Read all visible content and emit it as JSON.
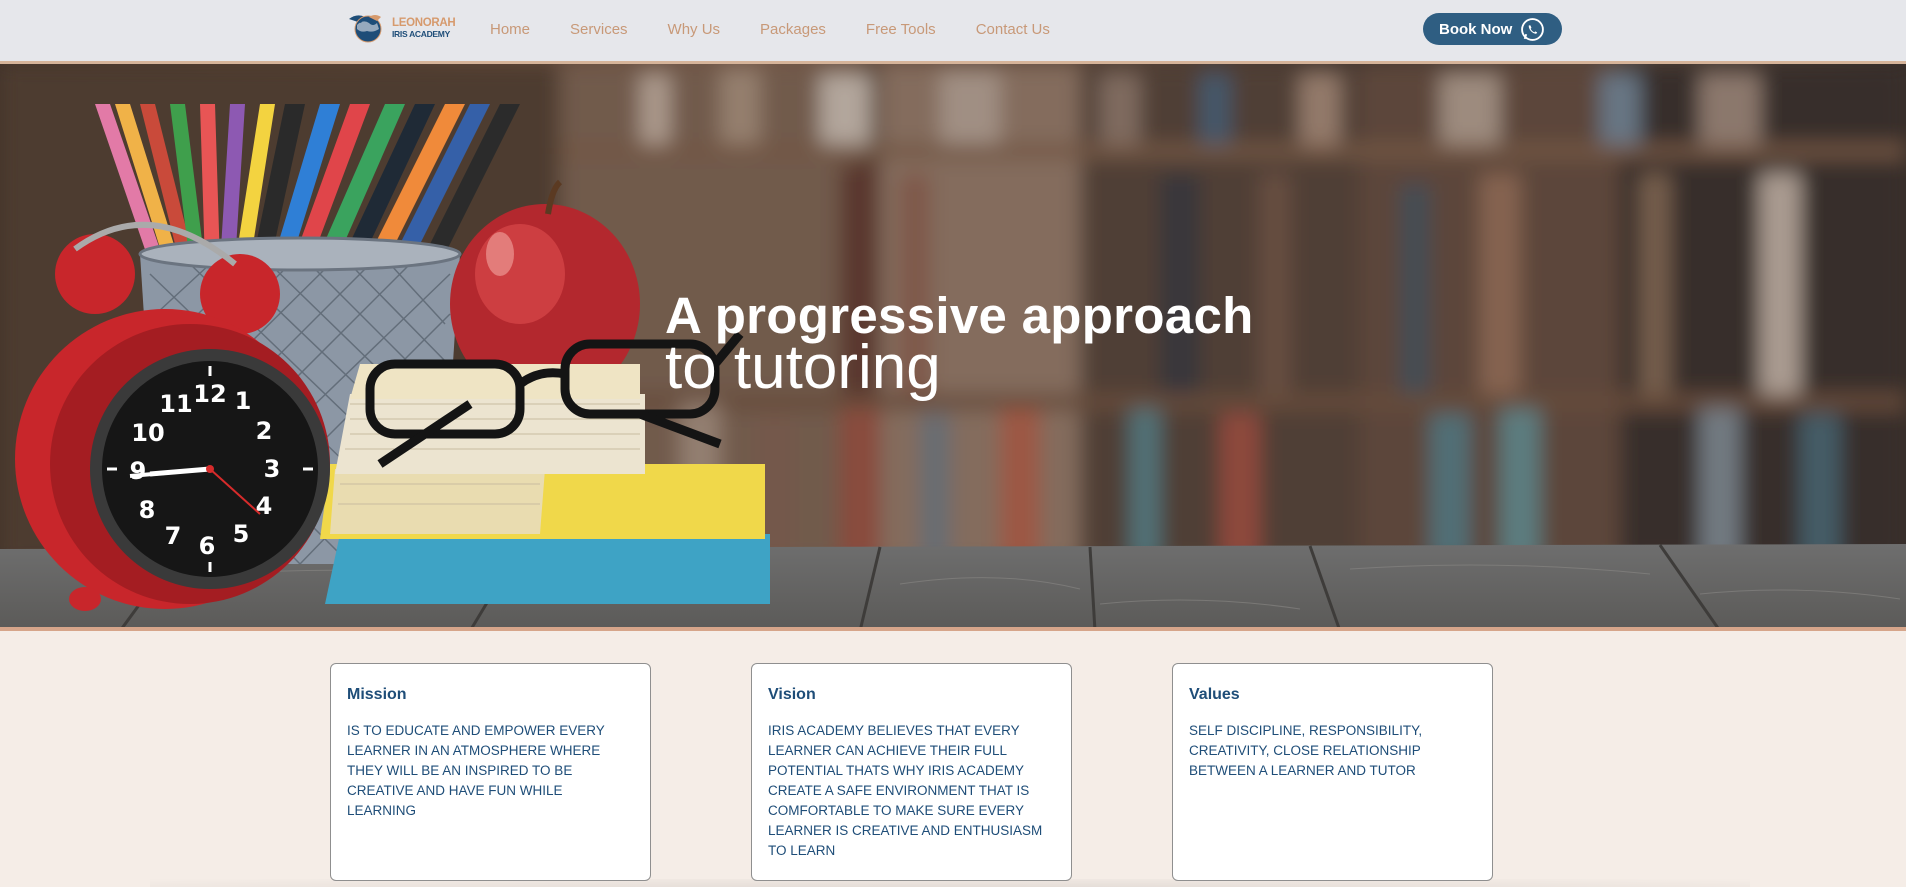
{
  "header": {
    "logo": {
      "line1": "LEONORAH",
      "line2": "IRIS ACADEMY"
    },
    "nav": [
      {
        "label": "Home"
      },
      {
        "label": "Services"
      },
      {
        "label": "Why Us"
      },
      {
        "label": "Packages"
      },
      {
        "label": "Free Tools"
      },
      {
        "label": "Contact Us"
      }
    ],
    "book_button": "Book Now"
  },
  "hero": {
    "title_line1": "A progressive approach",
    "title_line2": "to tutoring",
    "clock_numbers": [
      "12",
      "1",
      "2",
      "3",
      "4",
      "5",
      "6",
      "7",
      "8",
      "9",
      "10",
      "11"
    ]
  },
  "cards": [
    {
      "title": "Mission",
      "text": "IS TO EDUCATE AND EMPOWER EVERY LEARNER IN AN ATMOSPHERE WHERE THEY WILL BE AN INSPIRED TO BE CREATIVE AND HAVE FUN WHILE LEARNING"
    },
    {
      "title": "Vision",
      "text": "IRIS ACADEMY BELIEVES THAT EVERY LEARNER CAN ACHIEVE THEIR FULL POTENTIAL THATS WHY IRIS ACADEMY CREATE A SAFE ENVIRONMENT THAT IS COMFORTABLE TO MAKE SURE EVERY LEARNER IS CREATIVE AND ENTHUSIASM TO LEARN"
    },
    {
      "title": "Values",
      "text": "SELF DISCIPLINE, RESPONSIBILITY, CREATIVITY, CLOSE RELATIONSHIP BETWEEN A LEARNER AND TUTOR"
    }
  ],
  "colors": {
    "brand_blue": "#1e4d78",
    "brand_tan": "#d69a6d",
    "button_blue": "#2f5e82",
    "page_bg": "#f5ede7"
  }
}
